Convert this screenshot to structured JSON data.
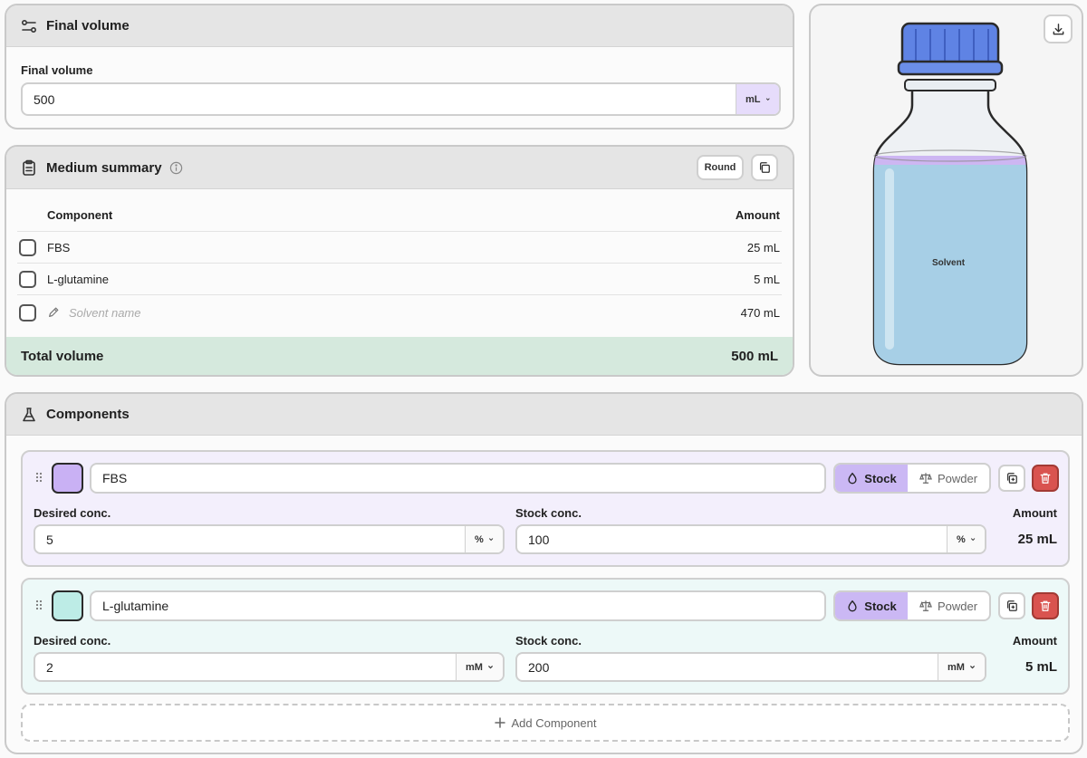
{
  "final_volume": {
    "header": "Final volume",
    "label": "Final volume",
    "value": "500",
    "unit": "mL"
  },
  "summary": {
    "header": "Medium summary",
    "round_label": "Round",
    "col_component": "Component",
    "col_amount": "Amount",
    "rows": [
      {
        "name": "FBS",
        "amount": "25 mL"
      },
      {
        "name": "L-glutamine",
        "amount": "5 mL"
      }
    ],
    "solvent_placeholder": "Solvent name",
    "solvent_amount": "470 mL",
    "total_label": "Total volume",
    "total_value": "500 mL"
  },
  "bottle": {
    "liquid_label": "Solvent",
    "liquid_fraction": 0.94,
    "colors": {
      "cap": "#5f83e4",
      "liquid": "#a7cfe6",
      "stock_band": "#cdb6f2"
    }
  },
  "components": {
    "header": "Components",
    "items": [
      {
        "name": "FBS",
        "color": "#c9b1f4",
        "mode_stock": "Stock",
        "mode_powder": "Powder",
        "desired_label": "Desired conc.",
        "desired_value": "5",
        "desired_unit": "%",
        "stock_label": "Stock conc.",
        "stock_value": "100",
        "stock_unit": "%",
        "amount_label": "Amount",
        "amount_value": "25 mL"
      },
      {
        "name": "L-glutamine",
        "color": "#bdece6",
        "mode_stock": "Stock",
        "mode_powder": "Powder",
        "desired_label": "Desired conc.",
        "desired_value": "2",
        "desired_unit": "mM",
        "stock_label": "Stock conc.",
        "stock_value": "200",
        "stock_unit": "mM",
        "amount_label": "Amount",
        "amount_value": "5 mL"
      }
    ],
    "add_label": "Add Component"
  }
}
